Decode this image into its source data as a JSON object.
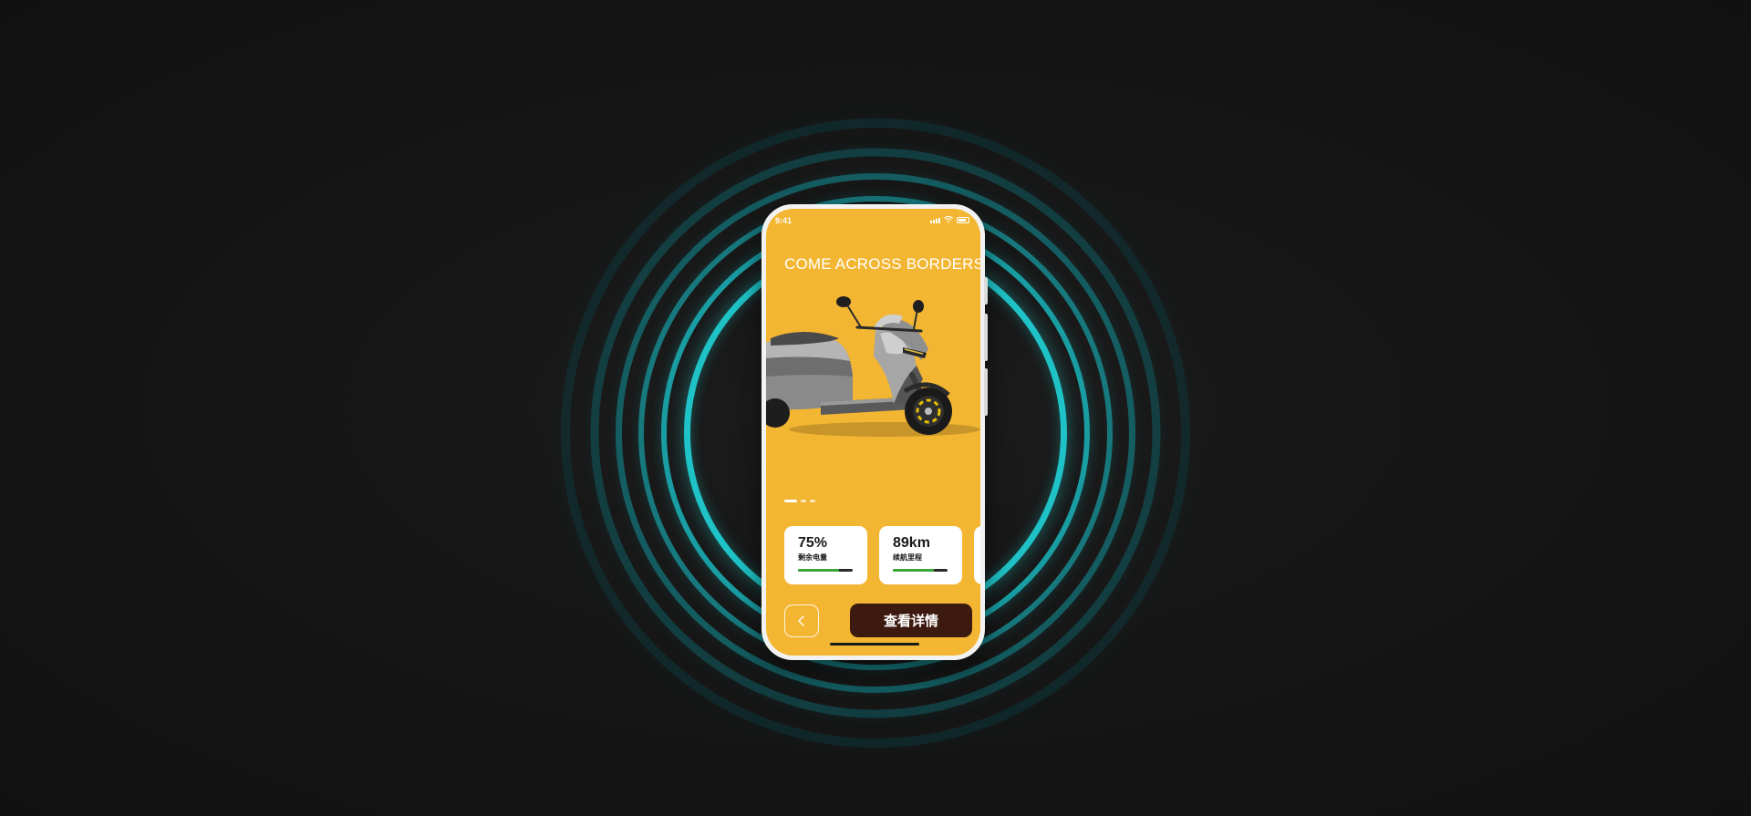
{
  "colors": {
    "background": "#141414",
    "ring": "#1fc3c7",
    "screen": "#f3b632",
    "button_dark": "#3d1a0f",
    "progress": "#3aa63a"
  },
  "status_bar": {
    "time": "9:41",
    "icons": [
      "signal-icon",
      "wifi-icon",
      "battery-icon"
    ]
  },
  "headline": "COME ACROSS BORDERS",
  "hero": {
    "image": "scooter-image"
  },
  "carousel": {
    "page_count": 3,
    "active_index": 0
  },
  "stats": [
    {
      "value": "75%",
      "label": "剩余电量",
      "progress": 0.75
    },
    {
      "value": "89km",
      "label": "续航里程",
      "progress": 0.75
    }
  ],
  "actions": {
    "back_icon": "chevron-left-icon",
    "detail_label": "查看详情"
  }
}
